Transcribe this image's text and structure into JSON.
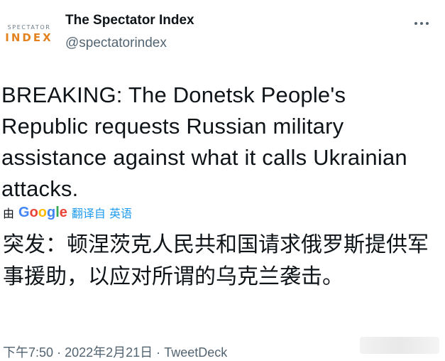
{
  "account": {
    "logo_top": "SPECTATOR",
    "logo_bottom": "INDEX",
    "display_name": "The Spectator Index",
    "handle": "@spectatorindex"
  },
  "menu": {
    "icon": "more-horizontal-icon"
  },
  "tweet": {
    "text": "BREAKING: The Donetsk People's Republic requests Russian military assistance against what it calls Ukrainian attacks."
  },
  "translation": {
    "by_label": "由",
    "provider_letters": [
      "G",
      "o",
      "o",
      "g",
      "l",
      "e"
    ],
    "link_label": "翻译自 英语",
    "text": "突发：顿涅茨克人民共和国请求俄罗斯提供军事援助，以应对所谓的乌克兰袭击。"
  },
  "meta": {
    "time": "下午7:50",
    "date": "2022年2月21日",
    "separator": "·",
    "source": "TweetDeck"
  },
  "colors": {
    "text": "#0f1419",
    "secondary": "#536471",
    "link": "#1d9bf0",
    "logo_accent": "#e3821f"
  }
}
